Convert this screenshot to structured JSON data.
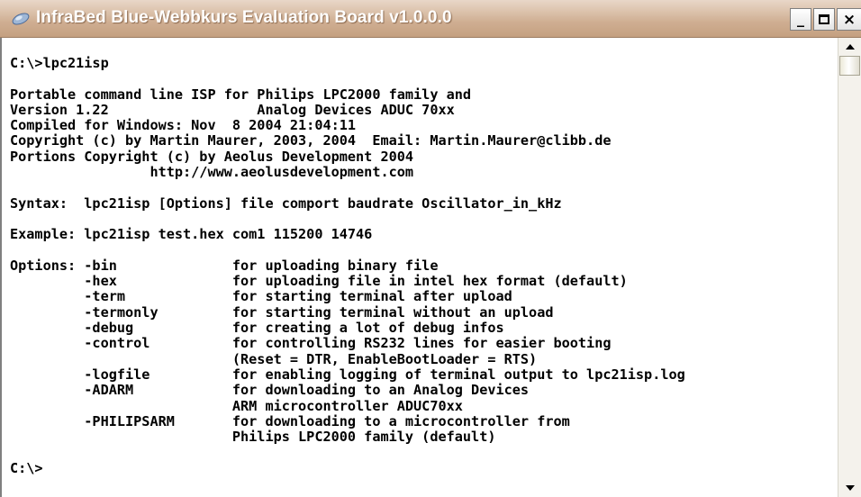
{
  "window": {
    "title": "InfraBed Blue-Webbkurs Evaluation Board v1.0.0.0",
    "icon": "console-icon",
    "controls": {
      "minimize": "_",
      "maximize": "maximize-icon",
      "close": "×"
    }
  },
  "console": {
    "lines": [
      "C:\\>lpc21isp",
      "",
      "Portable command line ISP for Philips LPC2000 family and",
      "Version 1.22                  Analog Devices ADUC 70xx",
      "Compiled for Windows: Nov  8 2004 21:04:11",
      "Copyright (c) by Martin Maurer, 2003, 2004  Email: Martin.Maurer@clibb.de",
      "Portions Copyright (c) by Aeolus Development 2004",
      "                 http://www.aeolusdevelopment.com",
      "",
      "Syntax:  lpc21isp [Options] file comport baudrate Oscillator_in_kHz",
      "",
      "Example: lpc21isp test.hex com1 115200 14746",
      "",
      "Options: -bin              for uploading binary file",
      "         -hex              for uploading file in intel hex format (default)",
      "         -term             for starting terminal after upload",
      "         -termonly         for starting terminal without an upload",
      "         -debug            for creating a lot of debug infos",
      "         -control          for controlling RS232 lines for easier booting",
      "                           (Reset = DTR, EnableBootLoader = RTS)",
      "         -logfile          for enabling logging of terminal output to lpc21isp.log",
      "         -ADARM            for downloading to an Analog Devices",
      "                           ARM microcontroller ADUC70xx",
      "         -PHILIPSARM       for downloading to a microcontroller from",
      "                           Philips LPC2000 family (default)",
      "",
      "C:\\>"
    ]
  }
}
